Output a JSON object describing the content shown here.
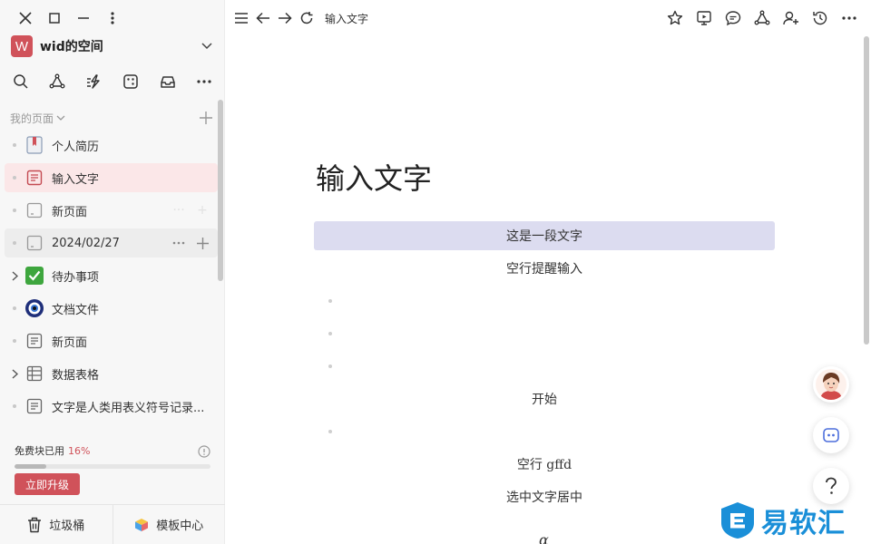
{
  "workspace": {
    "logo_letter": "W",
    "name": "wid的空间"
  },
  "sidebar": {
    "section_label": "我的页面",
    "pages": [
      {
        "label": "个人简历",
        "icon": "bookmark-book-icon"
      },
      {
        "label": "输入文字",
        "icon": "document-icon",
        "active": true
      },
      {
        "label": "新页面",
        "icon": "blank-page-icon"
      },
      {
        "label": "2024/02/27",
        "icon": "blank-page-icon",
        "hover": true
      },
      {
        "label": "待办事项",
        "icon": "checkbox-icon",
        "expandable": true
      },
      {
        "label": "文档文件",
        "icon": "eye-badge-icon"
      },
      {
        "label": "新页面",
        "icon": "document-icon"
      },
      {
        "label": "数据表格",
        "icon": "table-icon",
        "expandable": true
      },
      {
        "label": "文字是人类用表义符号记录...",
        "icon": "document-icon"
      }
    ],
    "usage": {
      "label": "免费块已用",
      "percent_text": "16%",
      "percent": 16
    },
    "upgrade_label": "立即升级",
    "trash_label": "垃圾桶",
    "templates_label": "模板中心"
  },
  "topbar": {
    "breadcrumb": "输入文字"
  },
  "document": {
    "title": "输入文字",
    "blocks": [
      {
        "text": "这是一段文字",
        "selected": true
      },
      {
        "text": "空行提醒输入"
      },
      {
        "text": "开始"
      },
      {
        "text": "空行 gffd"
      },
      {
        "text": "选中文字居中"
      }
    ],
    "formula_glyph": "α"
  },
  "watermark": {
    "text": "易软汇"
  },
  "colors": {
    "accent": "#d0525a",
    "selection": "#dcdcf0",
    "active_item": "#fbe7e8",
    "watermark": "#1a8fd8"
  }
}
